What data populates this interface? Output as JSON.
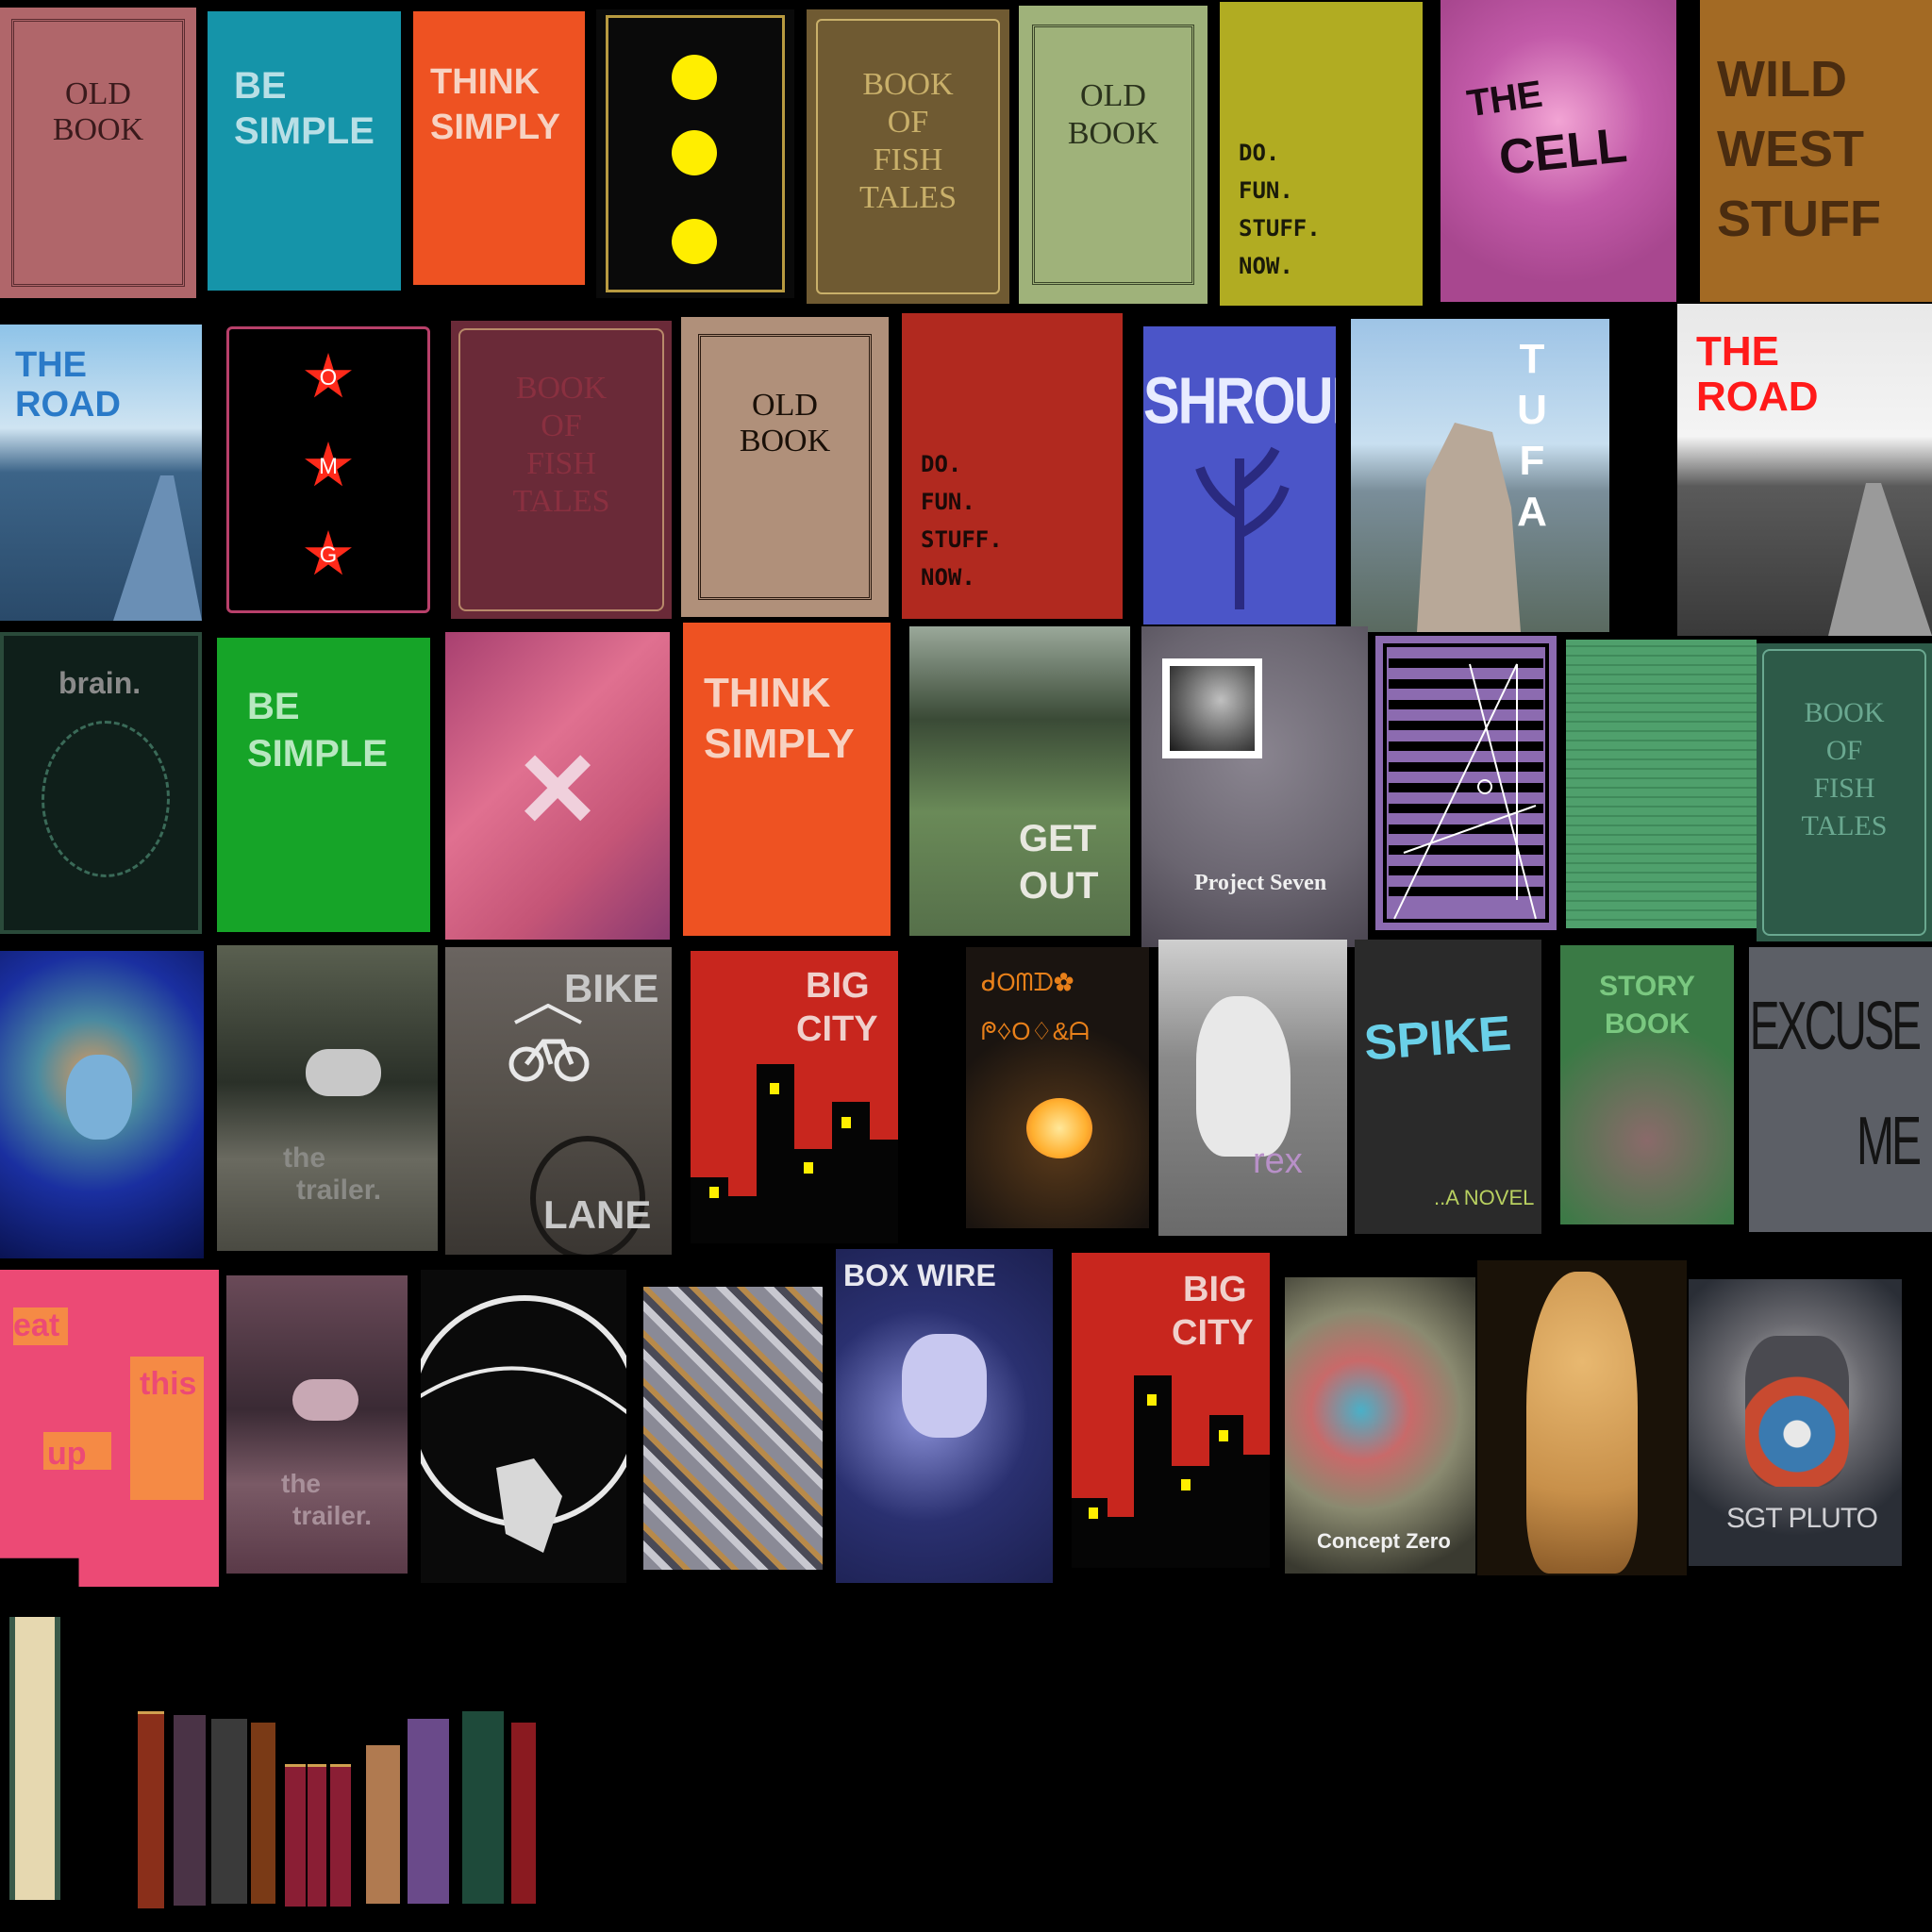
{
  "covers": {
    "c01": {
      "lines": [
        "OLD",
        "BOOK"
      ],
      "bg": "#b0666a"
    },
    "c02": {
      "lines": [
        "BE",
        "SIMPLE"
      ],
      "bg": "#1594a9"
    },
    "c03": {
      "lines": [
        "THINK",
        "SIMPLY"
      ],
      "bg": "#ee5222"
    },
    "c04": {
      "bg": "#0a0a0a",
      "accent": "#ffee00"
    },
    "c05": {
      "lines": [
        "BOOK",
        "OF",
        "FISH",
        "TALES"
      ],
      "bg": "#6f5a32"
    },
    "c06": {
      "lines": [
        "OLD",
        "BOOK"
      ],
      "bg": "#9fb27a"
    },
    "c07": {
      "lines": [
        "DO.",
        "FUN.",
        "STUFF.",
        "NOW."
      ],
      "bg": "#b1ac22"
    },
    "c08": {
      "lines": [
        "THE",
        "CELL"
      ],
      "bg": "#a8478f"
    },
    "c09": {
      "lines": [
        "WILD",
        "WEST",
        "STUFF"
      ],
      "bg": "#a36a24"
    },
    "c10": {
      "lines": [
        "THE",
        "ROAD"
      ],
      "bg": "#4a7aa3"
    },
    "c11": {
      "letters": [
        "O",
        "M",
        "G"
      ],
      "bg": "#000000"
    },
    "c12": {
      "lines": [
        "BOOK",
        "OF",
        "FISH",
        "TALES"
      ],
      "bg": "#6a2a38"
    },
    "c13": {
      "lines": [
        "OLD",
        "BOOK"
      ],
      "bg": "#b0907a"
    },
    "c14": {
      "lines": [
        "DO.",
        "FUN.",
        "STUFF.",
        "NOW."
      ],
      "bg": "#b1291f"
    },
    "c15": {
      "lines": [
        "SHROUD"
      ],
      "bg": "#4b55c8"
    },
    "c16": {
      "letters": [
        "T",
        "U",
        "F",
        "A"
      ],
      "bg": "#6e98c4"
    },
    "c17": {
      "lines": [
        "THE",
        "ROAD"
      ],
      "bg": "#8b8b8b"
    },
    "c18": {
      "lines": [
        "brain."
      ],
      "bg": "#0f1f1a"
    },
    "c19": {
      "lines": [
        "BE",
        "SIMPLE"
      ],
      "bg": "#16a428"
    },
    "c20": {
      "lines": [
        "×"
      ],
      "bg": "#c55577"
    },
    "c21": {
      "lines": [
        "THINK",
        "SIMPLY"
      ],
      "bg": "#ee5222"
    },
    "c22": {
      "lines": [
        "GET",
        "OUT"
      ],
      "bg": "#56704a"
    },
    "c23": {
      "lines": [
        "Project Seven"
      ],
      "bg": "#6a6570"
    },
    "c24": {
      "bg": "#8c6bb0"
    },
    "c25": {
      "bg": "#4fa06c"
    },
    "c26": {
      "lines": [
        "BOOK",
        "OF",
        "FISH",
        "TALES"
      ],
      "bg": "#2d5a48"
    },
    "c27": {
      "bg": "#1a2fa0"
    },
    "c28": {
      "lines": [
        "the",
        "trailer."
      ],
      "bg": "#3a4038"
    },
    "c29": {
      "lines": [
        "BIKE",
        "LANE"
      ],
      "bg": "#55504a"
    },
    "c30": {
      "lines": [
        "BIG",
        "CITY"
      ],
      "bg": "#c8261e"
    },
    "c31": {
      "lines": [
        "ᑯOᗰᗪ✿",
        "ᖘ♢O♢&ᗩ"
      ],
      "bg": "#1a1410"
    },
    "c32": {
      "lines": [
        "rex"
      ],
      "bg": "#7a7a7a"
    },
    "c33": {
      "lines": [
        "SPIKE",
        "..A NOVEL"
      ],
      "bg": "#2a2a2a"
    },
    "c34": {
      "lines": [
        "STORY",
        "BOOK"
      ],
      "bg": "#3a7a45"
    },
    "c35": {
      "lines": [
        "EXCUSE",
        "ME"
      ],
      "bg": "#5c5f66"
    },
    "c36": {
      "lines": [
        "eat",
        "this",
        "up"
      ],
      "bg": "#ec4a75",
      "accent": "#f58a45"
    },
    "c37": {
      "lines": [
        "the",
        "trailer."
      ],
      "bg": "#5a3a48"
    },
    "c38": {
      "bg": "#0a0a0a"
    },
    "c39": {
      "bg": "#8a8a96"
    },
    "c40": {
      "lines": [
        "BOX WIRE"
      ],
      "bg": "#1c2050"
    },
    "c41": {
      "lines": [
        "BIG",
        "CITY"
      ],
      "bg": "#c8261e"
    },
    "c42": {
      "lines": [
        "Concept Zero"
      ],
      "bg": "#6e6a5a"
    },
    "c43": {
      "bg": "#1a1208"
    },
    "c44": {
      "lines": [
        "SGT PLUTO"
      ],
      "bg": "#2a2e36"
    }
  },
  "spines": [
    {
      "color": "#e6d8b0"
    },
    {
      "color": "#8a2f1a"
    },
    {
      "color": "#4a3346"
    },
    {
      "color": "#3a3a3a"
    },
    {
      "color": "#7a3a16"
    },
    {
      "color": "#8a1e34"
    },
    {
      "color": "#8a1e34"
    },
    {
      "color": "#8a1e34"
    },
    {
      "color": "#b07a50"
    },
    {
      "color": "#6a4a8a"
    },
    {
      "color": "#1e4a3a"
    },
    {
      "color": "#8a1a20"
    }
  ]
}
